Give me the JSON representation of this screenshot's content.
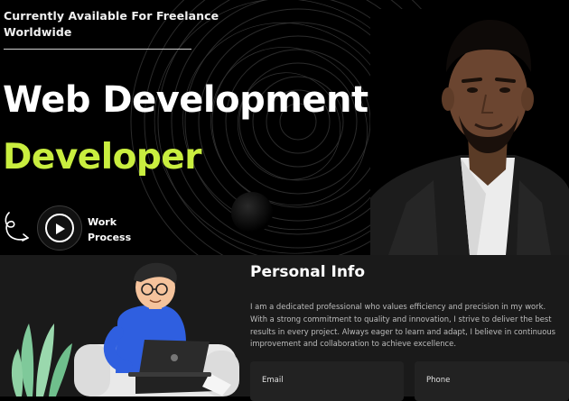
{
  "hero": {
    "availability_line1": "Currently Available For Freelance",
    "availability_line2": "Worldwide",
    "headline": "Web Development",
    "subheadline": "Developer",
    "work_process_line1": "Work",
    "work_process_line2": "Process",
    "accent_color": "#c9ee3f"
  },
  "icons": {
    "play": "play-icon",
    "doodle": "curly-arrow-icon"
  },
  "info": {
    "title": "Personal Info",
    "paragraph": "I am a dedicated professional who values efficiency and precision in my work. With a strong commitment to quality and innovation, I strive to deliver the best results in every project. Always eager to learn and adapt, I believe in continuous improvement and collaboration to achieve excellence.",
    "email_label": "Email",
    "phone_label": "Phone"
  }
}
